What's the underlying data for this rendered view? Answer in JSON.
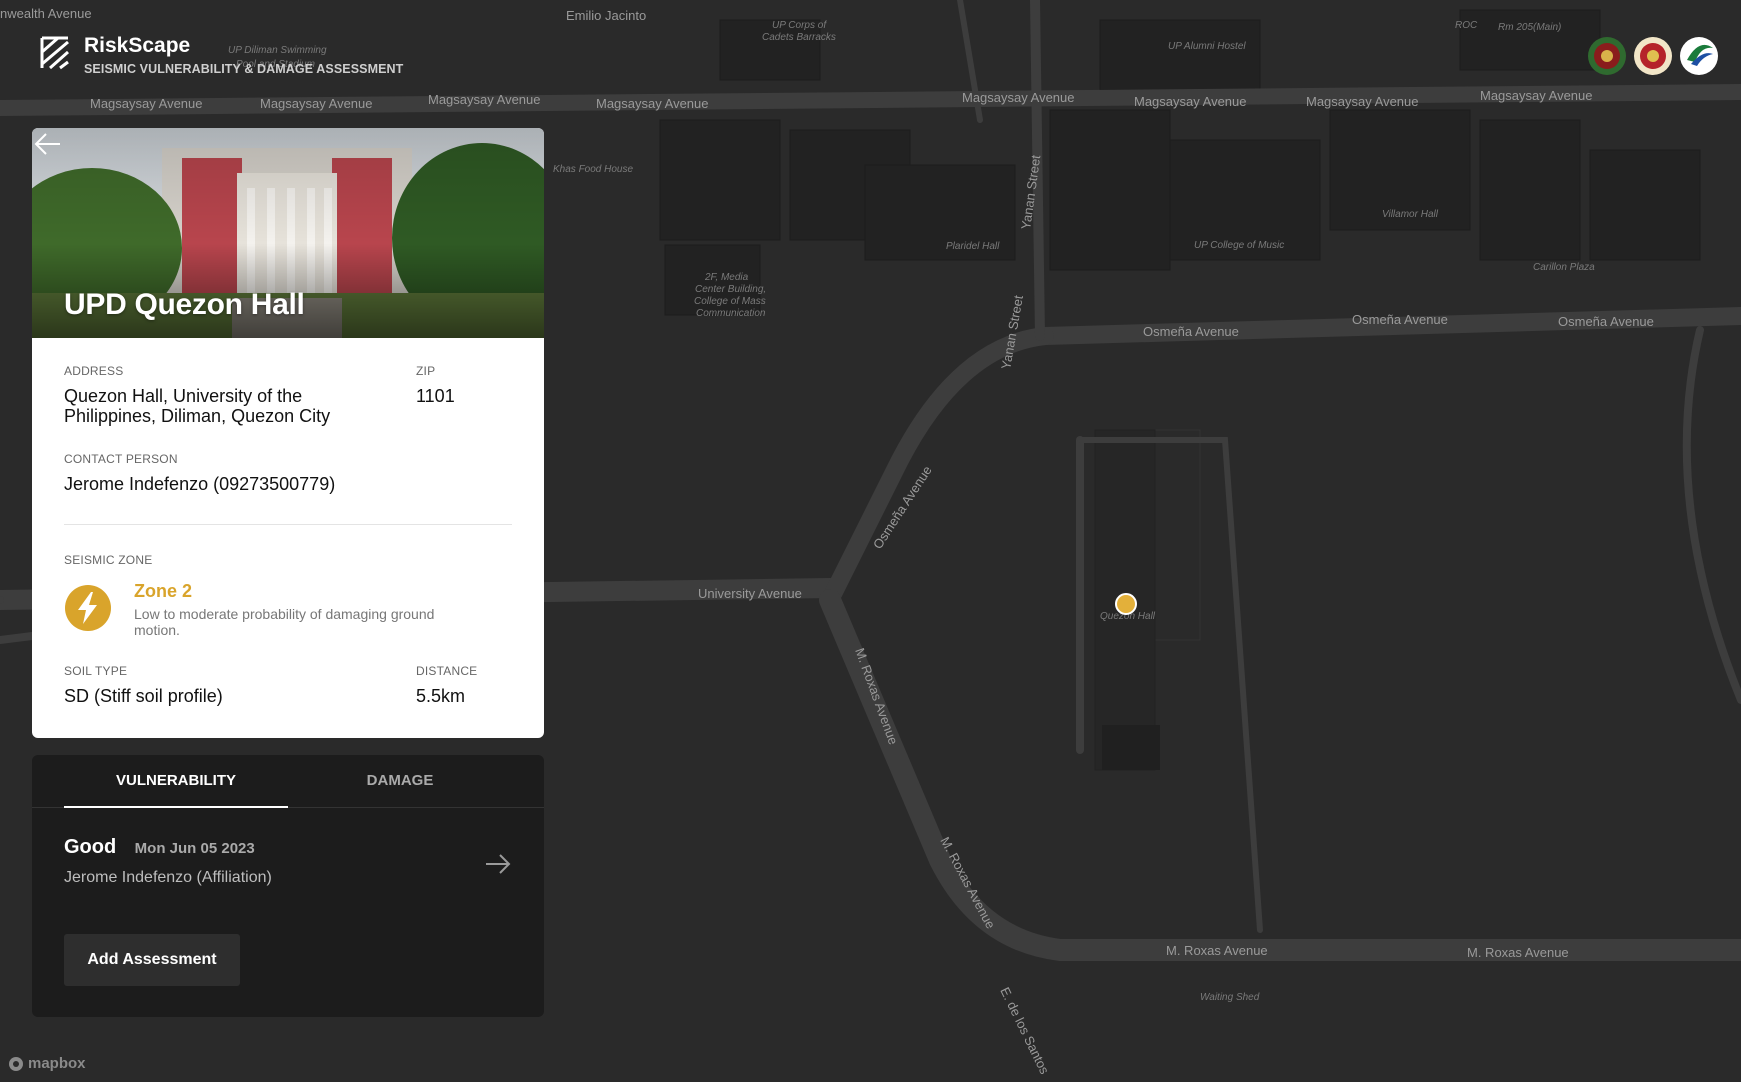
{
  "app": {
    "title": "RiskScape",
    "subtitle": "SEISMIC VULNERABILITY & DAMAGE ASSESSMENT"
  },
  "map": {
    "streets": [
      "Magsaysay Avenue",
      "Magsaysay Avenue",
      "Magsaysay Avenue",
      "Magsaysay Avenue",
      "Magsaysay Avenue",
      "Magsaysay Avenue",
      "Magsaysay Avenue",
      "Magsaysay Avenue",
      "Osmeña Avenue",
      "Osmeña Avenue",
      "Osmeña Avenue",
      "Osmeña Avenue",
      "University Avenue",
      "M. Roxas Avenue",
      "M. Roxas Avenue",
      "M. Roxas Avenue",
      "M. Roxas Avenue",
      "Yanan Street",
      "Yanan Street",
      "E. de los Santos",
      "nwealth Avenue",
      "Emilio Jacinto"
    ],
    "pois": [
      "UP Diliman Swimming",
      "Pool and Stadium",
      "UP Corps of",
      "Cadets Barracks",
      "UP Alumni Hostel",
      "Khas Food House",
      "Plaridel Hall",
      "UP College of Music",
      "Villamor Hall",
      "Carillon Plaza",
      "2F, Media",
      "Center Building,",
      "College of Mass",
      "Communication",
      "Quezon Hall",
      "Waiting Shed",
      "ROC",
      "Rm 205(Main)"
    ],
    "marker_label": "Quezon Hall",
    "attribution": "mapbox"
  },
  "building": {
    "name": "UPD Quezon Hall",
    "address_label": "ADDRESS",
    "address": "Quezon Hall, University of the Philippines, Diliman, Quezon City",
    "zip_label": "ZIP",
    "zip": "1101",
    "contact_label": "CONTACT PERSON",
    "contact": "Jerome Indefenzo (09273500779)",
    "seismic_label": "SEISMIC ZONE",
    "zone_title": "Zone 2",
    "zone_desc": "Low to moderate probability of damaging ground motion.",
    "soil_label": "SOIL TYPE",
    "soil": "SD (Stiff soil profile)",
    "distance_label": "DISTANCE",
    "distance": "5.5km"
  },
  "panel": {
    "tabs": [
      "VULNERABILITY",
      "DAMAGE"
    ],
    "active_tab": "VULNERABILITY",
    "entry": {
      "status": "Good",
      "date": "Mon Jun 05 2023",
      "person": "Jerome Indefenzo (Affiliation)"
    },
    "add_button": "Add Assessment"
  },
  "colors": {
    "accent": "#d9a42b",
    "marker": "#e3b03a",
    "card_bg": "#ffffff",
    "panel_bg": "#1c1c1c",
    "map_bg": "#2a2a2a"
  }
}
